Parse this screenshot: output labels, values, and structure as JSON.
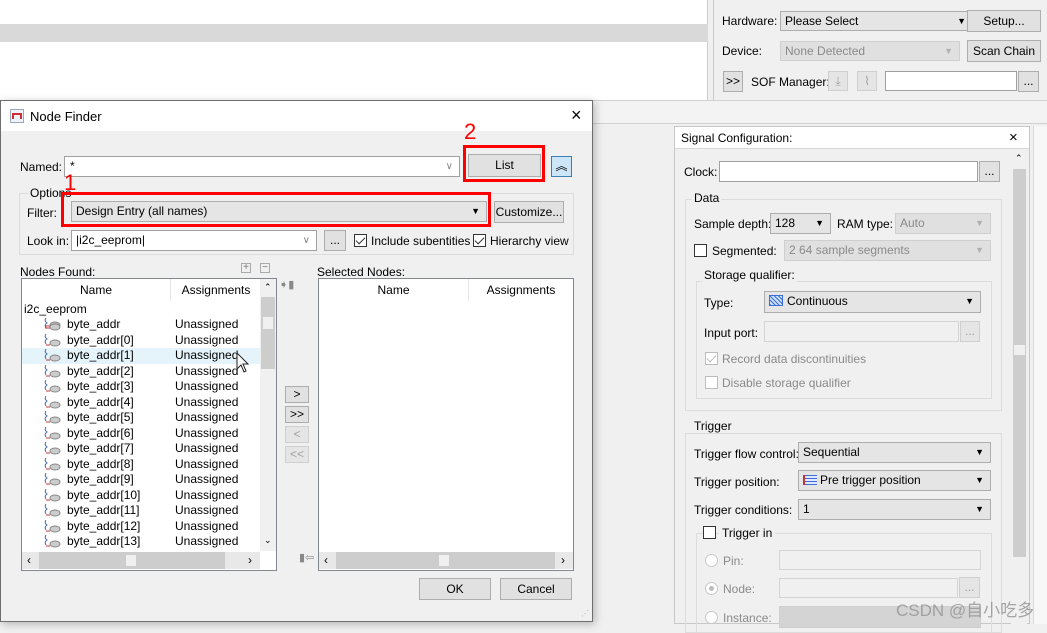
{
  "hardware_panel": {
    "hardware_label": "Hardware:",
    "hardware_value": "Please Select",
    "setup_button": "Setup...",
    "device_label": "Device:",
    "device_value": "None Detected",
    "scan_chain_button": "Scan Chain",
    "expand_button": ">>",
    "sof_manager_label": "SOF Manager:",
    "sof_file_value": "",
    "browse_button": "..."
  },
  "node_finder": {
    "title": "Node Finder",
    "close_icon": "×",
    "named_label": "Named:",
    "named_value": "*",
    "list_button": "List",
    "collapse_button": "︽",
    "options_label": "Options",
    "filter_label": "Filter:",
    "filter_value": "Design Entry (all names)",
    "customize_button": "Customize...",
    "look_in_label": "Look in:",
    "look_in_value": "|i2c_eeprom|",
    "look_in_browse": "...",
    "include_subentities_label": "Include subentities",
    "include_subentities_checked": true,
    "hierarchy_view_label": "Hierarchy view",
    "hierarchy_view_checked": true,
    "nodes_found_label": "Nodes Found:",
    "selected_nodes_label": "Selected Nodes:",
    "columns": {
      "name": "Name",
      "assignments": "Assignments"
    },
    "tree_root": "i2c_eeprom",
    "nodes": [
      {
        "name": "byte_addr",
        "assignment": "Unassigned",
        "bus": true
      },
      {
        "name": "byte_addr[0]",
        "assignment": "Unassigned"
      },
      {
        "name": "byte_addr[1]",
        "assignment": "Unassigned",
        "selected": true
      },
      {
        "name": "byte_addr[2]",
        "assignment": "Unassigned"
      },
      {
        "name": "byte_addr[3]",
        "assignment": "Unassigned"
      },
      {
        "name": "byte_addr[4]",
        "assignment": "Unassigned"
      },
      {
        "name": "byte_addr[5]",
        "assignment": "Unassigned"
      },
      {
        "name": "byte_addr[6]",
        "assignment": "Unassigned"
      },
      {
        "name": "byte_addr[7]",
        "assignment": "Unassigned"
      },
      {
        "name": "byte_addr[8]",
        "assignment": "Unassigned"
      },
      {
        "name": "byte_addr[9]",
        "assignment": "Unassigned"
      },
      {
        "name": "byte_addr[10]",
        "assignment": "Unassigned"
      },
      {
        "name": "byte_addr[11]",
        "assignment": "Unassigned"
      },
      {
        "name": "byte_addr[12]",
        "assignment": "Unassigned"
      },
      {
        "name": "byte_addr[13]",
        "assignment": "Unassigned"
      }
    ],
    "move_buttons": {
      "add": ">",
      "add_all": ">>",
      "remove": "<",
      "remove_all": "<<"
    },
    "ok_button": "OK",
    "cancel_button": "Cancel"
  },
  "annotations": {
    "step1": "1",
    "step2": "2",
    "color": "#ff0000"
  },
  "signal_configuration": {
    "title": "Signal Configuration:",
    "close_icon": "×",
    "clock_label": "Clock:",
    "clock_value": "",
    "clock_browse": "...",
    "data_group": "Data",
    "sample_depth_label": "Sample depth:",
    "sample_depth_value": "128",
    "ram_type_label": "RAM type:",
    "ram_type_value": "Auto",
    "segmented_label": "Segmented:",
    "segmented_checked": false,
    "segmented_value": "2  64 sample segments",
    "storage_qualifier_group": "Storage qualifier:",
    "type_label": "Type:",
    "type_value": "Continuous",
    "input_port_label": "Input port:",
    "input_port_browse": "...",
    "record_discontinuities_label": "Record data discontinuities",
    "record_discontinuities_checked": true,
    "disable_storage_qualifier_label": "Disable storage qualifier",
    "disable_storage_qualifier_checked": false,
    "trigger_group": "Trigger",
    "trigger_flow_control_label": "Trigger flow control:",
    "trigger_flow_control_value": "Sequential",
    "trigger_position_label": "Trigger position:",
    "trigger_position_value": "Pre trigger position",
    "trigger_conditions_label": "Trigger conditions:",
    "trigger_conditions_value": "1",
    "trigger_in_label": "Trigger in",
    "trigger_in_checked": false,
    "pin_label": "Pin:",
    "node_label": "Node:",
    "node_browse": "...",
    "instance_label": "Instance:"
  },
  "watermark": "CSDN @自小吃多"
}
